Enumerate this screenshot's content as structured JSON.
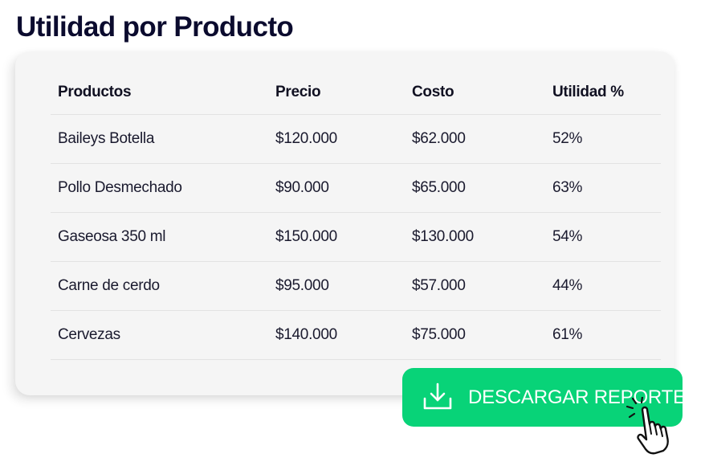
{
  "page": {
    "title": "Utilidad por Producto"
  },
  "table": {
    "headers": [
      "Productos",
      "Precio",
      "Costo",
      "Utilidad %"
    ],
    "rows": [
      [
        "Baileys Botella",
        "$120.000",
        "$62.000",
        "52%"
      ],
      [
        "Pollo Desmechado",
        "$90.000",
        "$65.000",
        "63%"
      ],
      [
        "Gaseosa 350 ml",
        "$150.000",
        "$130.000",
        "54%"
      ],
      [
        "Carne de cerdo",
        "$95.000",
        "$57.000",
        "44%"
      ],
      [
        "Cervezas",
        "$140.000",
        "$75.000",
        "61%"
      ]
    ]
  },
  "download_button": {
    "label": "DESCARGAR REPORTE",
    "icon": "download-icon",
    "color": "#08d378"
  },
  "cursor": {
    "icon": "hand-pointer-icon"
  }
}
